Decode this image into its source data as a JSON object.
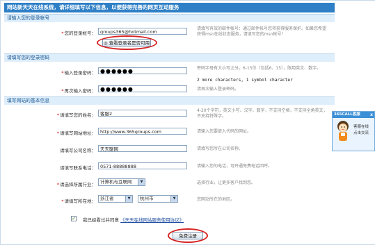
{
  "header": {
    "title": "网站新天天在线系统，请详细填写以下信息，以便获得完善的网页互动服务"
  },
  "sections": {
    "account": "请输入您的登录帐号",
    "password": "请填写您的登录密码",
    "website": "填写网站的基本信息"
  },
  "fields": {
    "login": {
      "label": "您的登录帐号：",
      "value": "groups365@hotmail.com"
    },
    "check_button": "查看登录名是否可用",
    "password": {
      "label": "输入登录密码：",
      "value": "●●●●●●"
    },
    "password2": {
      "label": "再次输入密码：",
      "value": "●●●●●●"
    },
    "name": {
      "label": "请填写您的姓名：",
      "value": "客服2"
    },
    "url": {
      "label": "请填写网站地址：",
      "value": "http://www.365groups.com"
    },
    "company": {
      "label": "请填写公司名称：",
      "value": "天天聊网"
    },
    "phone": {
      "label": "请填写联系电话：",
      "value": "0571-88888888"
    },
    "industry": {
      "label": "请选择所属行业：",
      "value": "计算机与互联网"
    },
    "location": {
      "label": "请填写所在地：",
      "province": "浙江省",
      "city": "杭州市"
    }
  },
  "hints": {
    "login": "请填写有效的邮件帐号：通过邮件帐号您将获得服务保护。如果您希望获得msn在线状态服务，请填写您的msn帐号！",
    "password": "密码字母有大小写之分。6-15位（包括6、15），限用英文、数字。",
    "password_extra": "2 more characters, 1 symbol character",
    "password2": "请再次输入登录密码。",
    "name": "4-20个字符，英文小写、汉字、数字，不支持空格，不支持全角英文，不支持特殊字。",
    "url": "请输入您要嵌入代码的网址。",
    "company": "请填写您所在公司名称。",
    "phone": "请输入您的电话，可开通免费电话回呼。",
    "industry": "选择行业，让更多客户找到您。",
    "location": "您网站所在的地区。"
  },
  "agree": {
    "prefix": "我已经看过并同意",
    "link": "《天天在线网站服务使用协议》"
  },
  "submit": "免费注册",
  "service": {
    "title": "365CALL客服",
    "close": "x",
    "line1": "客服在线",
    "line2": "点击交流"
  },
  "colors": {
    "header": "#2e7fc6",
    "section": "#dfeefb",
    "highlight": "#d62222"
  }
}
